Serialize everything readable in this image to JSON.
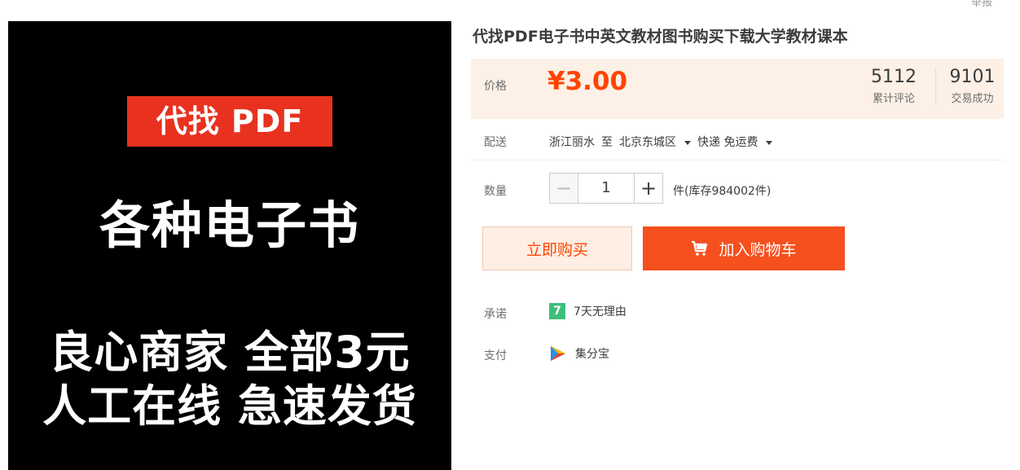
{
  "header": {
    "report_link": "举报"
  },
  "image": {
    "banner": "代找 PDF",
    "line1": "各种电子书",
    "line2": "良心商家 全部3元",
    "line3": "人工在线 急速发货"
  },
  "product": {
    "title": "代找PDF电子书中英文教材图书购买下载大学教材课本",
    "price_label": "价格",
    "price": "¥3.00",
    "comments_count": "5112",
    "comments_label": "累计评论",
    "trades_count": "9101",
    "trades_label": "交易成功"
  },
  "shipping": {
    "label": "配送",
    "from": "浙江丽水",
    "to_word": "至",
    "destination": "北京东城区",
    "method": "快递 免运费"
  },
  "quantity": {
    "label": "数量",
    "minus": "−",
    "value": "1",
    "plus": "+",
    "stock": "件(库存984002件)"
  },
  "actions": {
    "buy_now": "立即购买",
    "add_to_cart": "加入购物车"
  },
  "promise": {
    "label": "承诺",
    "icon_text": "7",
    "text": "7天无理由"
  },
  "payment": {
    "label": "支付",
    "text": "集分宝"
  },
  "colors": {
    "accent": "#f40",
    "cart_button": "#f5501e",
    "price_bg": "#fdf0e6",
    "promise_icon": "#3dbf7a"
  }
}
